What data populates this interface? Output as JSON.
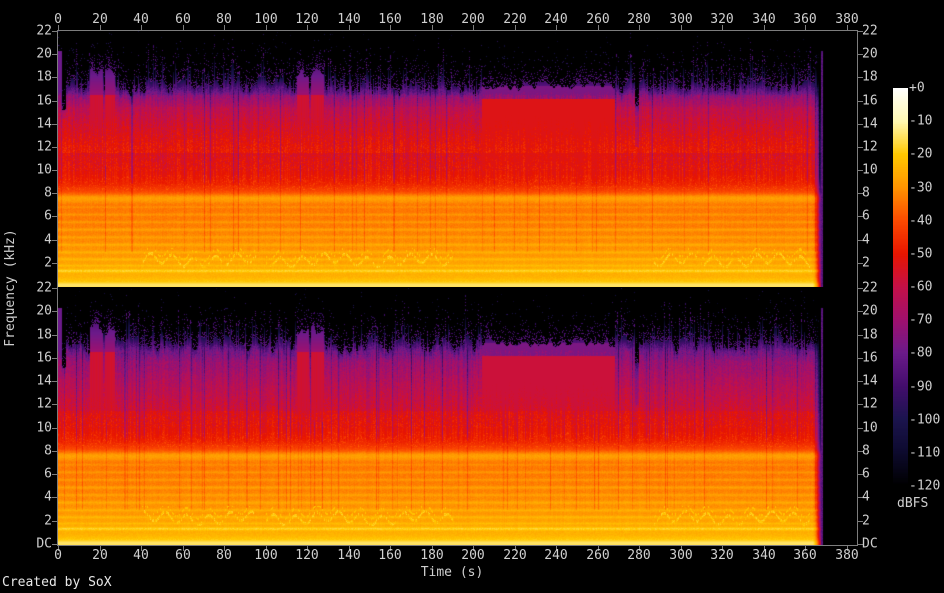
{
  "credit": "Created by SoX",
  "axes": {
    "time": {
      "title": "Time (s)",
      "tick_labels": [
        "0",
        "20",
        "40",
        "60",
        "80",
        "100",
        "120",
        "140",
        "160",
        "180",
        "200",
        "220",
        "240",
        "260",
        "280",
        "300",
        "320",
        "340",
        "360",
        "380"
      ]
    },
    "frequency": {
      "title": "Frequency (kHz)",
      "upper_panel_tick_labels": [
        "22",
        "20",
        "18",
        "16",
        "14",
        "12",
        "10",
        "8",
        "6",
        "4",
        "2"
      ],
      "lower_panel_tick_labels": [
        "22",
        "20",
        "18",
        "16",
        "14",
        "12",
        "10",
        "8",
        "6",
        "4",
        "2",
        "DC"
      ]
    }
  },
  "colorbar": {
    "title": "dBFS",
    "tick_labels": [
      "+0",
      "-10",
      "-20",
      "-30",
      "-40",
      "-50",
      "-60",
      "-70",
      "-80",
      "-90",
      "-100",
      "-110",
      "-120"
    ],
    "palette_stops": [
      [
        -120,
        "#000000"
      ],
      [
        -110,
        "#0d0a2e"
      ],
      [
        -100,
        "#1b144e"
      ],
      [
        -90,
        "#430d6d"
      ],
      [
        -80,
        "#6b1a8a"
      ],
      [
        -70,
        "#a0106e"
      ],
      [
        -60,
        "#c41048"
      ],
      [
        -50,
        "#e81500"
      ],
      [
        -40,
        "#fc4a00"
      ],
      [
        -30,
        "#ff9400"
      ],
      [
        -20,
        "#ffc800"
      ],
      [
        -10,
        "#fff8b0"
      ],
      [
        0,
        "#ffffff"
      ]
    ]
  },
  "chart_data": {
    "type": "heatmap",
    "subtype": "stereo audio spectrogram (SoX)",
    "panels": [
      "channel-1",
      "channel-2"
    ],
    "x_axis": {
      "label": "Time (s)",
      "min": 0,
      "max": 380,
      "tick_step": 20,
      "unit": "s"
    },
    "y_axis": {
      "label": "Frequency (kHz)",
      "min": 0,
      "max": 22,
      "tick_step": 2,
      "unit": "kHz"
    },
    "z_axis": {
      "label": "dBFS",
      "min": -120,
      "max": 0,
      "tick_step": 10
    },
    "audio_duration_s": 368,
    "frequency_profile_dbfs": [
      [
        0,
        -17
      ],
      [
        0.3,
        -19
      ],
      [
        0.8,
        -24
      ],
      [
        1.1,
        -25
      ],
      [
        2,
        -27
      ],
      [
        2.5,
        -29
      ],
      [
        5,
        -33
      ],
      [
        7,
        -34
      ],
      [
        7.3,
        -33
      ],
      [
        8.2,
        -41
      ],
      [
        8.8,
        -47
      ],
      [
        9.5,
        -50
      ],
      [
        11,
        -53
      ],
      [
        12.5,
        -57
      ],
      [
        14,
        -62
      ],
      [
        15.5,
        -68
      ],
      [
        16.5,
        -76
      ],
      [
        17.2,
        -84
      ],
      [
        17.8,
        -92
      ],
      [
        18.2,
        -100
      ],
      [
        22,
        -120
      ]
    ],
    "harmonic_bands_khz": [
      [
        0.15,
        4,
        0.18
      ],
      [
        1.35,
        8,
        0.14
      ],
      [
        1.8,
        4,
        0.1
      ],
      [
        2.35,
        5,
        0.13
      ],
      [
        2.95,
        5,
        0.13
      ],
      [
        3.6,
        5,
        0.13
      ],
      [
        4.25,
        4,
        0.12
      ],
      [
        4.9,
        5,
        0.13
      ],
      [
        5.55,
        4,
        0.11
      ],
      [
        6.2,
        4,
        0.11
      ],
      [
        6.85,
        3,
        0.1
      ],
      [
        7.65,
        8,
        0.33
      ]
    ],
    "noise_floor_edge_khz": 16.8,
    "events": [
      {
        "name": "attack-transient",
        "t": [
          0,
          1.7
        ]
      },
      {
        "name": "hf-gap",
        "t": [
          1.7,
          3.4
        ]
      },
      {
        "name": "noise-burst",
        "t": [
          15,
          21.4
        ]
      },
      {
        "name": "noise-burst",
        "t": [
          22.4,
          27
        ]
      },
      {
        "name": "noise-burst",
        "t": [
          115,
          120.5
        ]
      },
      {
        "name": "noise-burst",
        "t": [
          121.5,
          128
        ]
      },
      {
        "name": "loud-section",
        "t": [
          204,
          268
        ]
      },
      {
        "name": "hf-notch",
        "t": [
          277.5,
          279.8
        ]
      },
      {
        "name": "fade-out",
        "t": [
          363,
          367.3
        ]
      },
      {
        "name": "end-transient",
        "t": [
          367.3,
          368.4
        ]
      },
      {
        "name": "silence",
        "t": [
          368.4,
          385
        ]
      }
    ],
    "vocal_pattern_windows_s": [
      [
        40,
        95
      ],
      [
        100,
        190
      ],
      [
        287,
        362
      ]
    ]
  }
}
